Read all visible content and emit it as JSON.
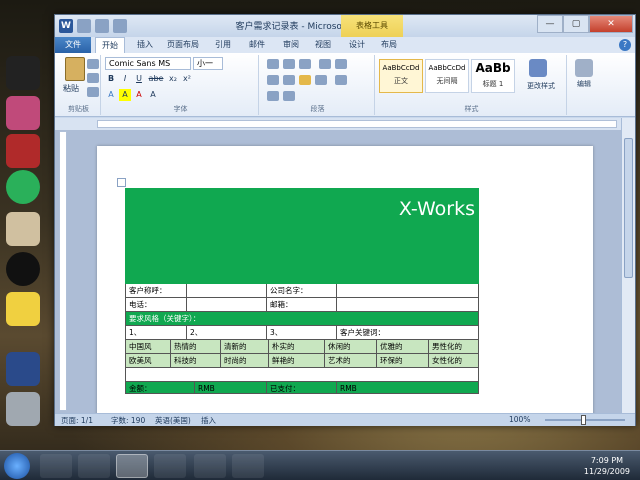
{
  "window": {
    "title": "客户需求记录表 - Microsoft Word",
    "context_tab": "表格工具",
    "logo": "W",
    "controls": {
      "minimize": "—",
      "maximize": "▢",
      "close": "✕"
    }
  },
  "tabs": [
    "文件",
    "开始",
    "插入",
    "页面布局",
    "引用",
    "邮件",
    "审阅",
    "视图",
    "设计",
    "布局"
  ],
  "ribbon": {
    "clipboard": {
      "paste": "粘贴",
      "label": "剪贴板"
    },
    "font": {
      "name": "Comic Sans MS",
      "size": "小一",
      "label": "字体",
      "buttons": [
        "B",
        "I",
        "U",
        "abe",
        "x₂",
        "x²",
        "A",
        "A",
        "A",
        "A"
      ]
    },
    "paragraph": {
      "label": "段落"
    },
    "styles": {
      "label": "样式",
      "items": [
        {
          "sample": "AaBbCcDd",
          "name": "正文"
        },
        {
          "sample": "AaBbCcDd",
          "name": "无间隔"
        },
        {
          "sample": "AaBb",
          "name": "标题 1"
        }
      ],
      "change": "更改样式"
    },
    "editing": {
      "label": "编辑"
    }
  },
  "document": {
    "brand": "X-Works",
    "rows": [
      [
        "客户称呼：",
        "",
        "公司名字：",
        ""
      ],
      [
        "电话：",
        "",
        "邮箱：",
        ""
      ]
    ],
    "section_title": "要求风格（关键字）：",
    "numbered": [
      "1、",
      "2、",
      "3、"
    ],
    "keyword_label": "客户关键词：",
    "styles_row1": [
      "中国风",
      "热情的",
      "清新的",
      "朴实的",
      "休闲的",
      "优雅的",
      "男性化的"
    ],
    "styles_row2": [
      "欧美风",
      "科技的",
      "时尚的",
      "鲜艳的",
      "艺术的",
      "环保的",
      "女性化的"
    ],
    "amount_label": "金额：",
    "amount_unit": "RMB",
    "paid_label": "已支付：",
    "paid_unit": "RMB"
  },
  "status": {
    "page": "页面: 1/1",
    "words": "字数: 190",
    "lang": "英语(美国)",
    "mode": "插入",
    "zoom": "100%"
  },
  "taskbar": {
    "time": "7:09 PM",
    "date": "11/29/2009"
  },
  "colors": {
    "header_green": "#10a850",
    "light_green": "#c8e6c0"
  }
}
